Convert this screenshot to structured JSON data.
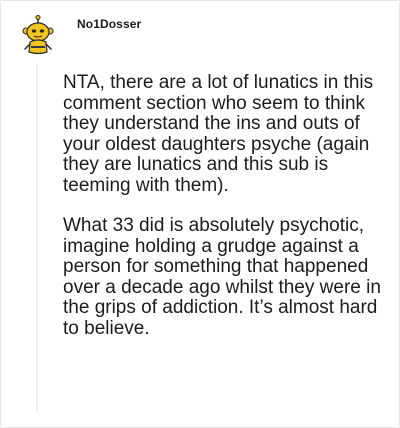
{
  "comment": {
    "author": {
      "username": "No1Dosser",
      "avatar_icon": "snoo-avatar-icon"
    },
    "paragraphs": [
      "NTA, there are a lot of lunatics in this comment section who seem to think they understand the ins and outs of your oldest daughters psyche (again they are lunatics and this sub is teeming with them).",
      "What 33 did is absolutely psychotic, imagine holding a grudge against a person for something that happened over a decade ago whilst they were in the grips of addiction. It’s almost hard to believe."
    ]
  },
  "colors": {
    "text": "#1c1c1c",
    "thread_line": "#edeff1",
    "avatar_body": "#f2c41c",
    "avatar_outline": "#2b2b2b"
  }
}
